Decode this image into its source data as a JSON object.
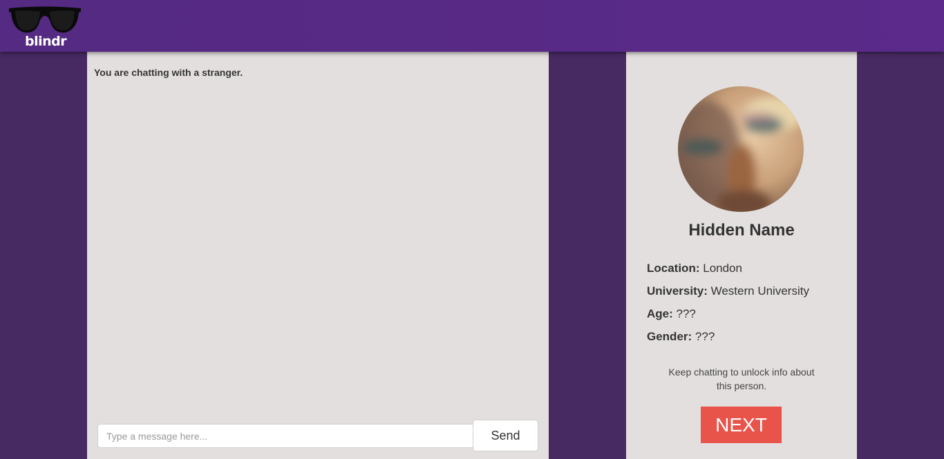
{
  "header": {
    "logo_text": "blindr",
    "logo_icon": "sunglasses-icon"
  },
  "chat": {
    "status_text": "You are chatting with a stranger.",
    "input_placeholder": "Type a message here...",
    "input_value": "",
    "send_label": "Send"
  },
  "profile": {
    "avatar": "blurred-profile-photo",
    "name": "Hidden Name",
    "fields": [
      {
        "label": "Location:",
        "value": "London"
      },
      {
        "label": "University:",
        "value": "Western University"
      },
      {
        "label": "Age:",
        "value": "???"
      },
      {
        "label": "Gender:",
        "value": "???"
      }
    ],
    "unlock_note": "Keep chatting to unlock info about this person.",
    "next_label": "NEXT"
  },
  "colors": {
    "header_bg": "#572a86",
    "page_bg": "#482a63",
    "panel_bg": "#e4dfdf",
    "next_button": "#e8534a"
  }
}
